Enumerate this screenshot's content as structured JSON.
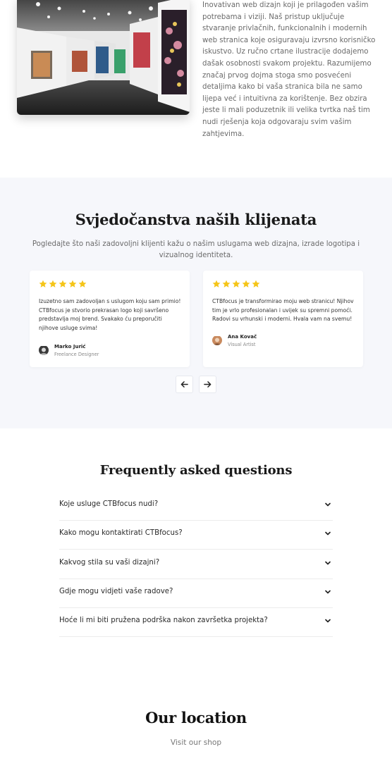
{
  "intro": {
    "image_alt": "art gallery",
    "paragraph": "Inovativan web dizajn koji je prilagođen vašim potrebama i viziji. Naš pristup uključuje stvaranje privlačnih, funkcionalnih i modernih web stranica koje osiguravaju izvrsno korisničko iskustvo. Uz ručno crtane ilustracije dodajemo dašak osobnosti svakom projektu. Razumijemo značaj prvog dojma stoga smo posvećeni detaljima kako bi vaša stranica bila ne samo lijepa već i intuitivna za korištenje. Bez obzira jeste li mali poduzetnik ili velika tvrtka naš tim nudi rješenja koja odgovaraju svim vašim zahtjevima."
  },
  "testimonials": {
    "title": "Svjedočanstva naših klijenata",
    "subtitle": "Pogledajte što naši zadovoljni klijenti kažu o našim uslugama web dizajna, izrade logotipa i vizualnog identiteta.",
    "star_color": "#f5c518",
    "cards": [
      {
        "rating": 5,
        "text": "Izuzetno sam zadovoljan s uslugom koju sam primio! CTBfocus je stvorio prekrasan logo koji savršeno predstavlja moj brend. Svakako ću preporučiti njihove usluge svima!",
        "name": "Marko Jurić",
        "role": "Freelance Designer"
      },
      {
        "rating": 5,
        "text": "CTBfocus je transformirao moju web stranicu! Njihov tim je vrlo profesionalan i uvijek su spremni pomoći. Radovi su vrhunski i moderni. Hvala vam na svemu!",
        "name": "Ana Kovač",
        "role": "Visual Artist"
      }
    ],
    "prev_icon": "arrow-left-icon",
    "next_icon": "arrow-right-icon"
  },
  "faq": {
    "title": "Frequently asked questions",
    "items": [
      "Koje usluge CTBfocus nudi?",
      "Kako mogu kontaktirati CTBfocus?",
      "Kakvog stila su vaši dizajni?",
      "Gdje mogu vidjeti vaše radove?",
      "Hoće li mi biti pružena podrška nakon završetka projekta?"
    ],
    "chevron_icon": "chevron-down-icon"
  },
  "location": {
    "title": "Our location",
    "subtitle": "Visit our shop"
  }
}
